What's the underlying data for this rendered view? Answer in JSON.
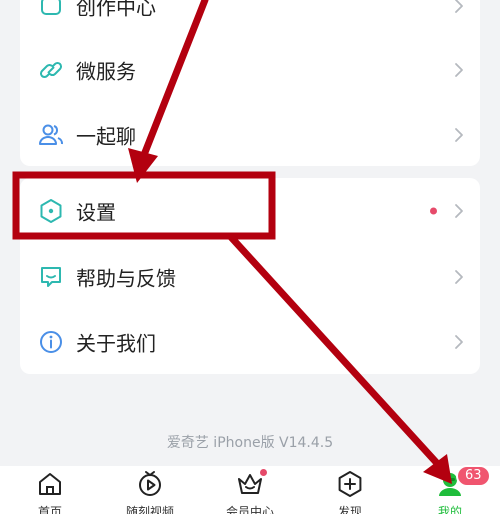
{
  "menu_group_a": [
    {
      "label": "创作中心",
      "icon": "creator-center-icon"
    },
    {
      "label": "微服务",
      "icon": "micro-service-link-icon"
    },
    {
      "label": "一起聊",
      "icon": "chat-people-icon"
    }
  ],
  "menu_group_b": [
    {
      "label": "设置",
      "icon": "settings-hexagon-icon",
      "has_dot": true
    },
    {
      "label": "帮助与反馈",
      "icon": "help-feedback-icon"
    },
    {
      "label": "关于我们",
      "icon": "about-info-icon"
    }
  ],
  "version_text": "爱奇艺 iPhone版 V14.4.5",
  "tabbar": [
    {
      "label": "首页",
      "icon": "home-icon"
    },
    {
      "label": "随刻视频",
      "icon": "play-video-icon"
    },
    {
      "label": "会员中心",
      "icon": "crown-vip-icon",
      "has_dot": true
    },
    {
      "label": "发现",
      "icon": "plus-discover-icon"
    },
    {
      "label": "我的",
      "icon": "profile-avatar-icon",
      "active": true
    }
  ],
  "profile_badge": "63",
  "colors": {
    "accent_green": "#1fbd3b",
    "icon_teal": "#2db8b0",
    "icon_blue": "#4a8fe7",
    "annotation_red": "#b3000f",
    "notification_red": "#f0556f"
  }
}
